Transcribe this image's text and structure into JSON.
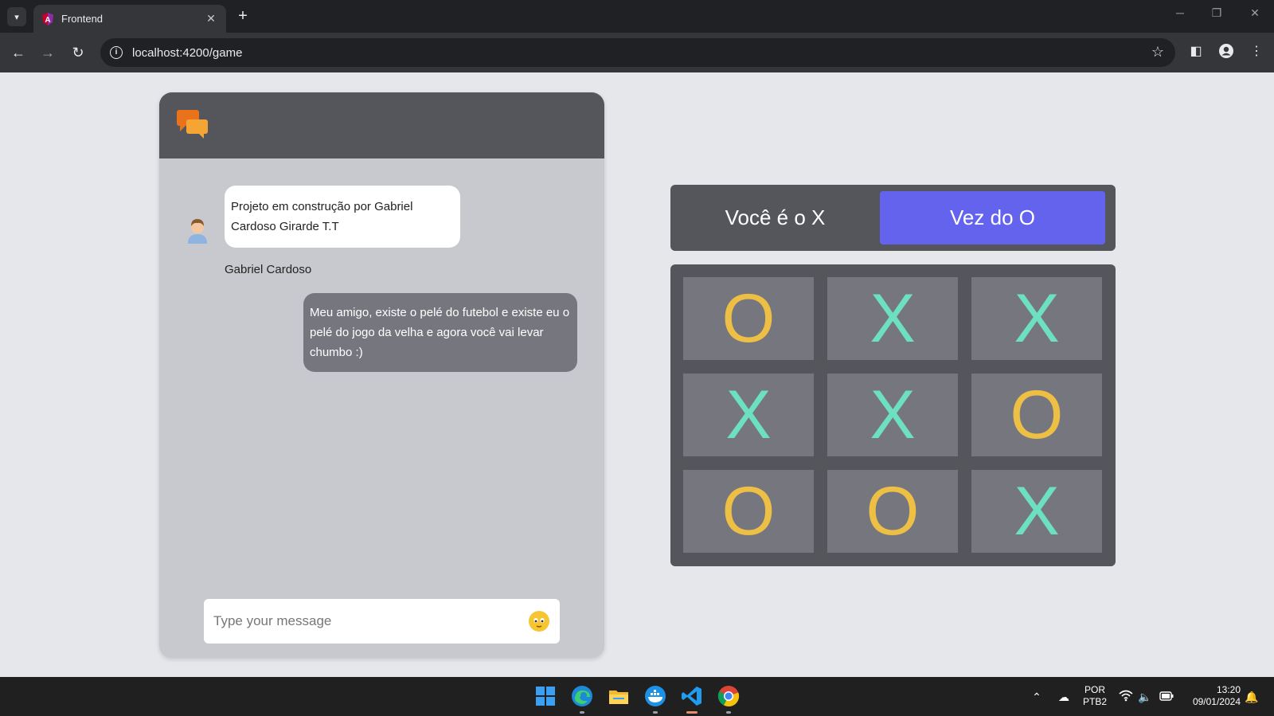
{
  "browser": {
    "tab_title": "Frontend",
    "url": "localhost:4200/game",
    "new_tab_label": "+",
    "tab_close_label": "✕"
  },
  "chat": {
    "bot_message": "Projeto em construção por Gabriel Cardoso Girarde T.T",
    "bot_name": "Gabriel Cardoso",
    "user_message": "Meu amigo, existe o pelé do futebol e existe eu o pelé do jogo da velha e agora você vai levar chumbo :)",
    "input_placeholder": "Type your message"
  },
  "game": {
    "player_label": "Você é o X",
    "turn_label": "Vez do O",
    "board": [
      "O",
      "X",
      "X",
      "X",
      "X",
      "O",
      "O",
      "O",
      "X"
    ],
    "colors": {
      "x": "#6de0c0",
      "o": "#eebf45",
      "turn_bg": "#6363ee"
    }
  },
  "taskbar": {
    "language_line1": "POR",
    "language_line2": "PTB2",
    "time": "13:20",
    "date": "09/01/2024",
    "apps": [
      "windows-start-icon",
      "edge-icon",
      "file-explorer-icon",
      "docker-icon",
      "vscode-icon",
      "chrome-icon"
    ]
  }
}
